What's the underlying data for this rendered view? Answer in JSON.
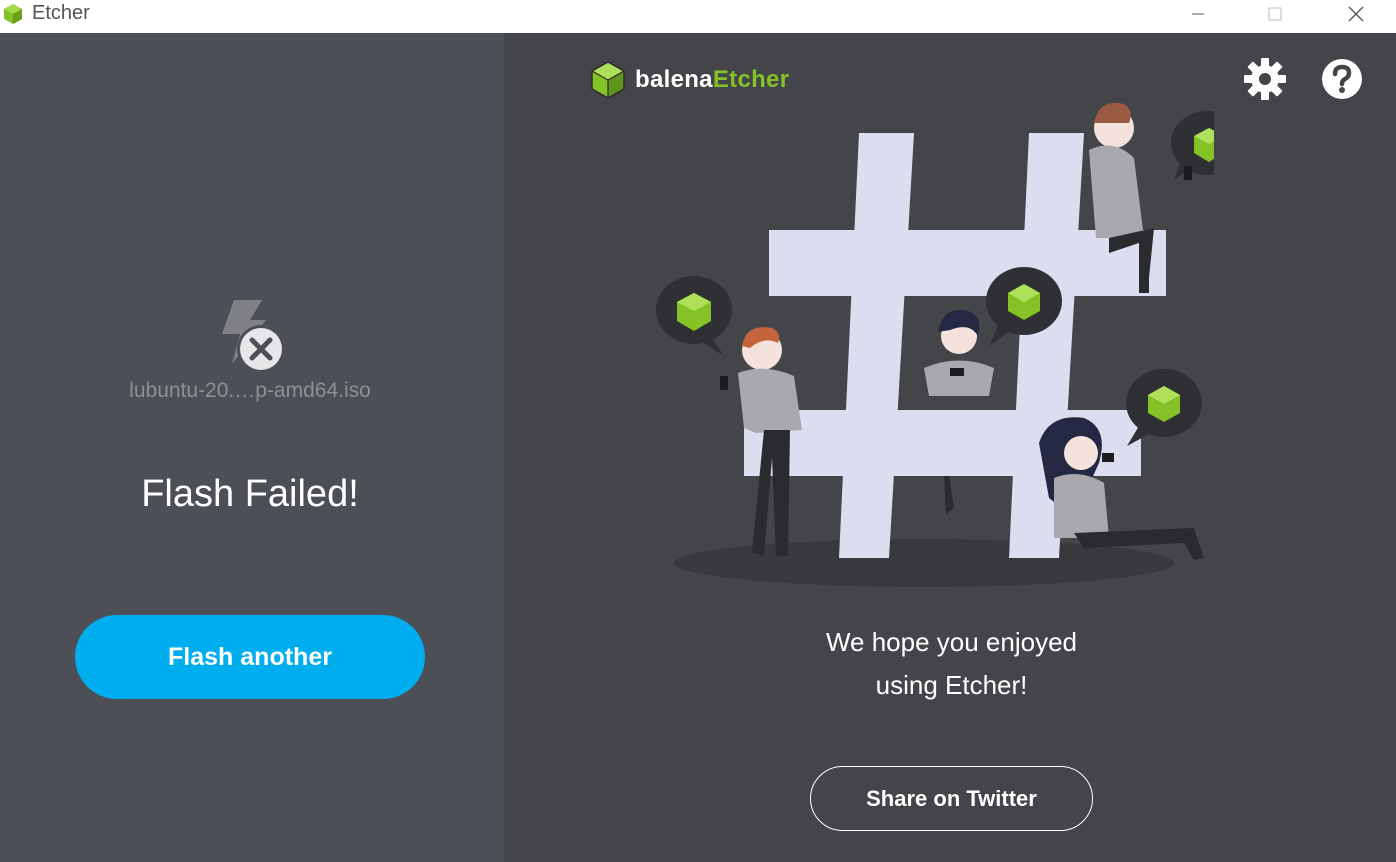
{
  "window": {
    "title": "Etcher",
    "minimize_icon": "minimize-icon",
    "maximize_icon": "maximize-icon",
    "close_icon": "close-icon"
  },
  "left_panel": {
    "file_name": "lubuntu-20.…p-amd64.iso",
    "status_title": "Flash Failed!",
    "flash_another_label": "Flash another",
    "status_icon": "flash-failed-icon"
  },
  "header": {
    "logo_text_primary": "balena",
    "logo_text_accent": "Etcher",
    "settings_icon": "gear-icon",
    "help_icon": "help-icon"
  },
  "right_panel": {
    "thanks_line1": "We hope you enjoyed",
    "thanks_line2": "using Etcher!",
    "share_label": "Share on Twitter",
    "illustration": "hashtag-people-illustration"
  },
  "colors": {
    "accent_blue": "#00aeef",
    "brand_green": "#85c226",
    "left_bg": "#4d4f56",
    "right_bg": "#434549"
  }
}
